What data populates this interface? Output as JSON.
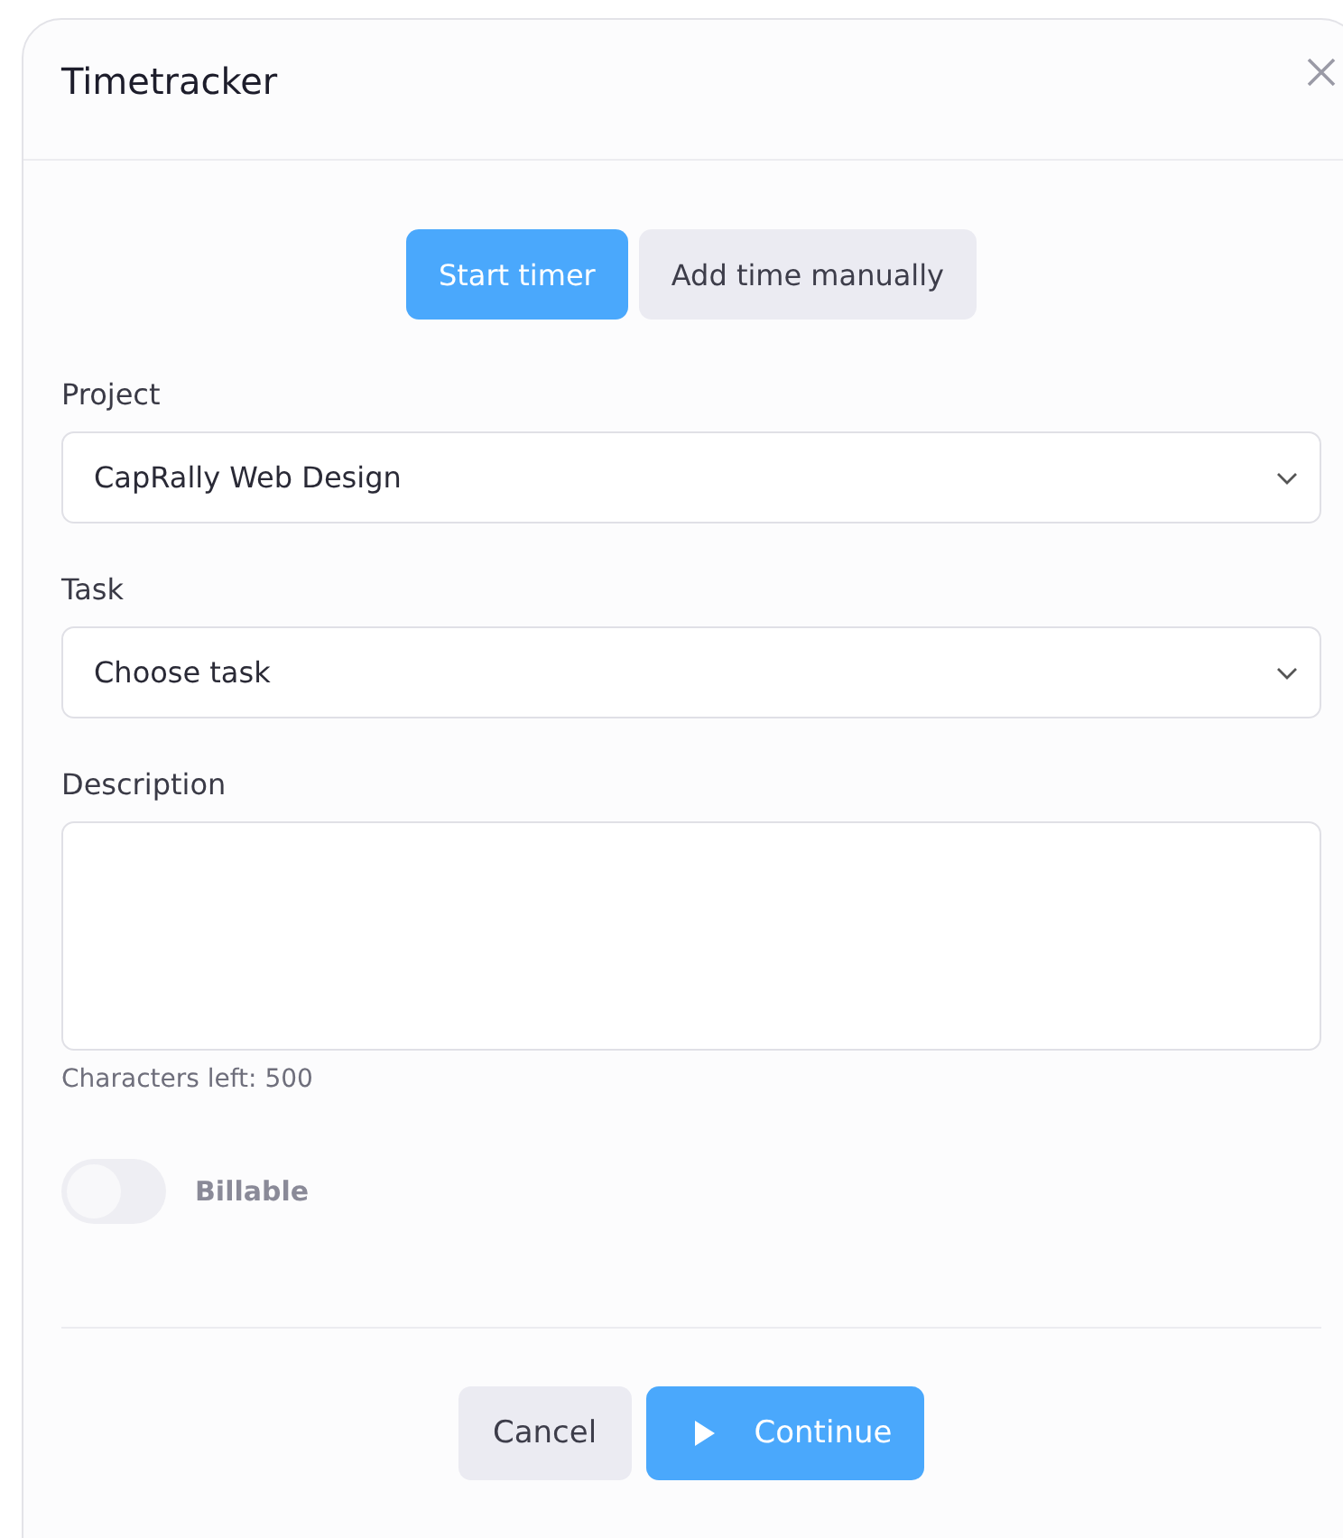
{
  "dialog": {
    "title": "Timetracker"
  },
  "modes": [
    {
      "label": "Start timer",
      "selected": true
    },
    {
      "label": "Add time manually",
      "selected": false
    }
  ],
  "selects": [
    {
      "label": "Project",
      "value": "CapRally Web Design"
    },
    {
      "label": "Task",
      "value": "Choose task"
    }
  ],
  "description": {
    "label": "Description",
    "counter": "Characters left: 500"
  },
  "billable": {
    "label": "Billable",
    "on": false
  },
  "buttons": [
    {
      "kind": "secondary",
      "label": "Cancel"
    },
    {
      "kind": "primary",
      "label": "Continue"
    }
  ]
}
